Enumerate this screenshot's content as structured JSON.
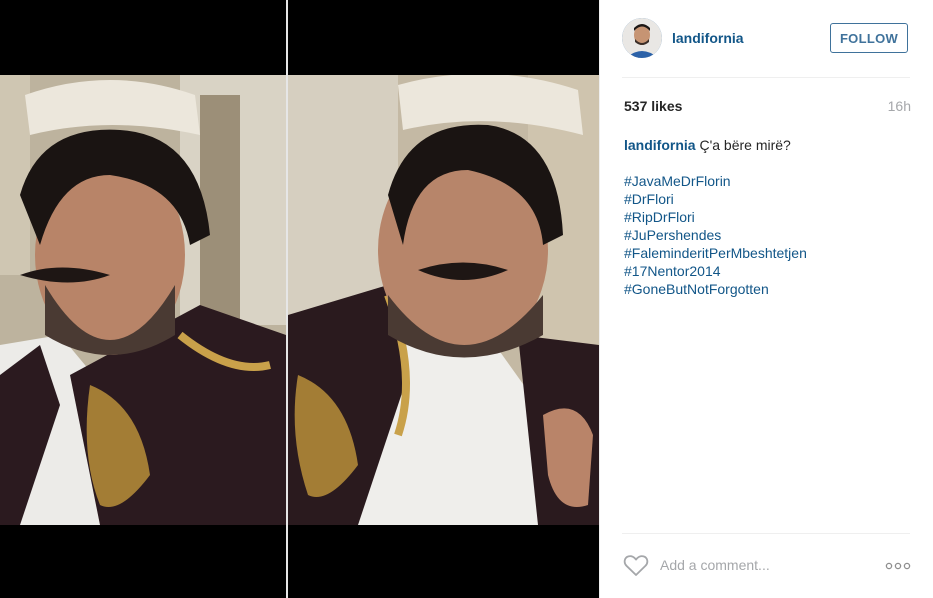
{
  "post": {
    "username": "landifornia",
    "follow_label": "FOLLOW",
    "likes": "537 likes",
    "time": "16h",
    "caption_user": "landifornia",
    "caption_text": " Ç'a bëre mirë?",
    "hashtags": [
      "#JavaMeDrFlorin",
      "#DrFlori",
      "#RipDrFlori",
      "#JuPershendes",
      "#FaleminderitPerMbeshtetjen",
      "#17Nentor2014",
      "#GoneButNotForgotten"
    ]
  },
  "comment": {
    "placeholder": "Add a comment..."
  },
  "icons": {
    "like": "heart-icon",
    "more": "more-options-icon"
  },
  "colors": {
    "link": "#125688",
    "follow": "#3f729b",
    "muted": "#a5a7aa"
  }
}
